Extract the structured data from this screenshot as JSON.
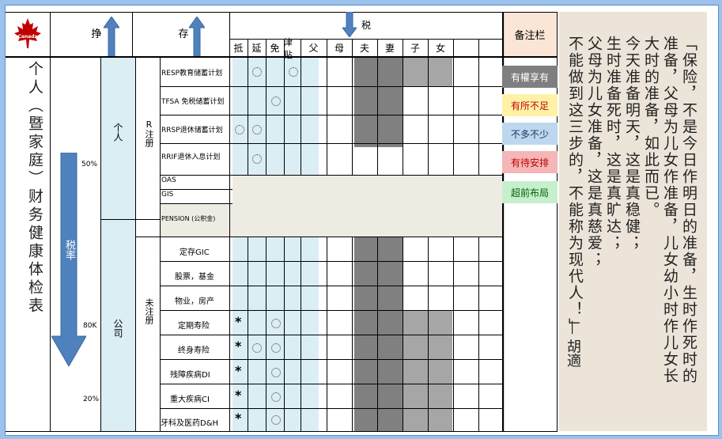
{
  "header": {
    "deduct_label": "挣",
    "save_label": "存",
    "tax_label": "税",
    "tax_columns": [
      "抵",
      "延",
      "免",
      "津贴",
      "父",
      "母",
      "夫",
      "妻",
      "子",
      "女",
      "",
      ""
    ],
    "notes_label": "备注栏"
  },
  "logo": {
    "text": "Canada"
  },
  "left_title": "个人（暨家庭）财务健康体检表",
  "tax_rate": {
    "label": "税率",
    "levels": [
      "50%",
      "80K",
      "20%"
    ]
  },
  "entity": {
    "personal": "个人",
    "company": "公司"
  },
  "registered": {
    "registered": "R注册",
    "unregistered": "未注册"
  },
  "rows": [
    "RESP教育储蓄计划",
    "TFSA 免税储蓄计划",
    "RRSP退休储蓄计划",
    "RRIF退休入息计划",
    "OAS",
    "GIS",
    "PENSION (公积金)",
    "定存GIC",
    "股票，基金",
    "物业，房产",
    "定期寿险",
    "终身寿险",
    "残障疾病DI",
    "重大疾病CI",
    "牙科及医药D&H"
  ],
  "legend": [
    {
      "label": "有權享有",
      "color": "#7f7f7f",
      "text_color": "#ffffff"
    },
    {
      "label": "有所不足",
      "color": "#fff2a6",
      "text_color": "#c00000"
    },
    {
      "label": "不多不少",
      "color": "#bdd7ee",
      "text_color": "#1f3864"
    },
    {
      "label": "有待安排",
      "color": "#f4b6b6",
      "text_color": "#c00000"
    },
    {
      "label": "超前布局",
      "color": "#c6efce",
      "text_color": "#006100"
    }
  ],
  "calligraphy": {
    "columns": [
      "「保险，不是今日作明日的准备，生时作死时的",
      "准备，父母为儿女作准备，儿女幼小时作儿女长",
      "大时的准备，如此而已。",
      "今天准备明天，这是真稳健；",
      "生时准备死时，这是真旷达；",
      "父母为儿女准备，这是真慈爱；",
      "不能做到这三步的，不能称为现代人！」"
    ],
    "signature": "— 胡適"
  },
  "colors": {
    "light_blue": "#daeef3",
    "grey": "#808080",
    "light_grey": "#a6a6a6",
    "beige": "#eeebe2",
    "arrow": "#4f81bd",
    "notes_header": "#fbe5d6",
    "logo_red": "#c00000"
  }
}
